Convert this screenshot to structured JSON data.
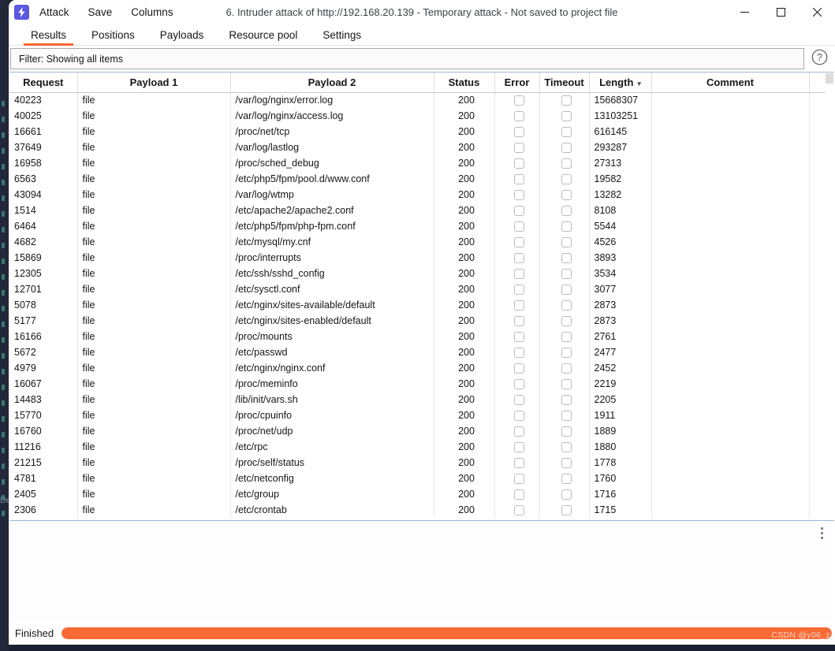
{
  "window": {
    "app_icon": "burp-lightning-icon",
    "title": "6. Intruder attack of http://192.168.20.139 - Temporary attack - Not saved to project file",
    "menu": [
      "Attack",
      "Save",
      "Columns"
    ],
    "controls": {
      "minimize": "minimize-icon",
      "maximize": "maximize-icon",
      "close": "close-icon"
    }
  },
  "tabs": [
    {
      "label": "Results",
      "active": true
    },
    {
      "label": "Positions",
      "active": false
    },
    {
      "label": "Payloads",
      "active": false
    },
    {
      "label": "Resource pool",
      "active": false
    },
    {
      "label": "Settings",
      "active": false
    }
  ],
  "filter": {
    "text": "Filter: Showing all items",
    "help_icon": "question-mark-icon"
  },
  "table": {
    "columns": [
      {
        "key": "request",
        "label": "Request"
      },
      {
        "key": "payload1",
        "label": "Payload 1"
      },
      {
        "key": "payload2",
        "label": "Payload 2"
      },
      {
        "key": "status",
        "label": "Status"
      },
      {
        "key": "error",
        "label": "Error"
      },
      {
        "key": "timeout",
        "label": "Timeout"
      },
      {
        "key": "length",
        "label": "Length",
        "sorted": "desc",
        "sort_icon": "chevron-down-icon"
      },
      {
        "key": "comment",
        "label": "Comment"
      }
    ],
    "rows": [
      {
        "request": "40223",
        "payload1": "file",
        "payload2": "/var/log/nginx/error.log",
        "status": "200",
        "error": false,
        "timeout": false,
        "length": "15668307",
        "comment": ""
      },
      {
        "request": "40025",
        "payload1": "file",
        "payload2": "/var/log/nginx/access.log",
        "status": "200",
        "error": false,
        "timeout": false,
        "length": "13103251",
        "comment": ""
      },
      {
        "request": "16661",
        "payload1": "file",
        "payload2": "/proc/net/tcp",
        "status": "200",
        "error": false,
        "timeout": false,
        "length": "616145",
        "comment": ""
      },
      {
        "request": "37649",
        "payload1": "file",
        "payload2": "/var/log/lastlog",
        "status": "200",
        "error": false,
        "timeout": false,
        "length": "293287",
        "comment": ""
      },
      {
        "request": "16958",
        "payload1": "file",
        "payload2": "/proc/sched_debug",
        "status": "200",
        "error": false,
        "timeout": false,
        "length": "27313",
        "comment": ""
      },
      {
        "request": "6563",
        "payload1": "file",
        "payload2": "/etc/php5/fpm/pool.d/www.conf",
        "status": "200",
        "error": false,
        "timeout": false,
        "length": "19582",
        "comment": ""
      },
      {
        "request": "43094",
        "payload1": "file",
        "payload2": "/var/log/wtmp",
        "status": "200",
        "error": false,
        "timeout": false,
        "length": "13282",
        "comment": ""
      },
      {
        "request": "1514",
        "payload1": "file",
        "payload2": "/etc/apache2/apache2.conf",
        "status": "200",
        "error": false,
        "timeout": false,
        "length": "8108",
        "comment": ""
      },
      {
        "request": "6464",
        "payload1": "file",
        "payload2": "/etc/php5/fpm/php-fpm.conf",
        "status": "200",
        "error": false,
        "timeout": false,
        "length": "5544",
        "comment": ""
      },
      {
        "request": "4682",
        "payload1": "file",
        "payload2": "/etc/mysql/my.cnf",
        "status": "200",
        "error": false,
        "timeout": false,
        "length": "4526",
        "comment": ""
      },
      {
        "request": "15869",
        "payload1": "file",
        "payload2": "/proc/interrupts",
        "status": "200",
        "error": false,
        "timeout": false,
        "length": "3893",
        "comment": ""
      },
      {
        "request": "12305",
        "payload1": "file",
        "payload2": "/etc/ssh/sshd_config",
        "status": "200",
        "error": false,
        "timeout": false,
        "length": "3534",
        "comment": ""
      },
      {
        "request": "12701",
        "payload1": "file",
        "payload2": "/etc/sysctl.conf",
        "status": "200",
        "error": false,
        "timeout": false,
        "length": "3077",
        "comment": ""
      },
      {
        "request": "5078",
        "payload1": "file",
        "payload2": "/etc/nginx/sites-available/default",
        "status": "200",
        "error": false,
        "timeout": false,
        "length": "2873",
        "comment": ""
      },
      {
        "request": "5177",
        "payload1": "file",
        "payload2": "/etc/nginx/sites-enabled/default",
        "status": "200",
        "error": false,
        "timeout": false,
        "length": "2873",
        "comment": ""
      },
      {
        "request": "16166",
        "payload1": "file",
        "payload2": "/proc/mounts",
        "status": "200",
        "error": false,
        "timeout": false,
        "length": "2761",
        "comment": ""
      },
      {
        "request": "5672",
        "payload1": "file",
        "payload2": "/etc/passwd",
        "status": "200",
        "error": false,
        "timeout": false,
        "length": "2477",
        "comment": ""
      },
      {
        "request": "4979",
        "payload1": "file",
        "payload2": "/etc/nginx/nginx.conf",
        "status": "200",
        "error": false,
        "timeout": false,
        "length": "2452",
        "comment": ""
      },
      {
        "request": "16067",
        "payload1": "file",
        "payload2": "/proc/meminfo",
        "status": "200",
        "error": false,
        "timeout": false,
        "length": "2219",
        "comment": ""
      },
      {
        "request": "14483",
        "payload1": "file",
        "payload2": "/lib/init/vars.sh",
        "status": "200",
        "error": false,
        "timeout": false,
        "length": "2205",
        "comment": ""
      },
      {
        "request": "15770",
        "payload1": "file",
        "payload2": "/proc/cpuinfo",
        "status": "200",
        "error": false,
        "timeout": false,
        "length": "1911",
        "comment": ""
      },
      {
        "request": "16760",
        "payload1": "file",
        "payload2": "/proc/net/udp",
        "status": "200",
        "error": false,
        "timeout": false,
        "length": "1889",
        "comment": ""
      },
      {
        "request": "11216",
        "payload1": "file",
        "payload2": "/etc/rpc",
        "status": "200",
        "error": false,
        "timeout": false,
        "length": "1880",
        "comment": ""
      },
      {
        "request": "21215",
        "payload1": "file",
        "payload2": "/proc/self/status",
        "status": "200",
        "error": false,
        "timeout": false,
        "length": "1778",
        "comment": ""
      },
      {
        "request": "4781",
        "payload1": "file",
        "payload2": "/etc/netconfig",
        "status": "200",
        "error": false,
        "timeout": false,
        "length": "1760",
        "comment": ""
      },
      {
        "request": "2405",
        "payload1": "file",
        "payload2": "/etc/group",
        "status": "200",
        "error": false,
        "timeout": false,
        "length": "1716",
        "comment": ""
      },
      {
        "request": "2306",
        "payload1": "file",
        "payload2": "/etc/crontab",
        "status": "200",
        "error": false,
        "timeout": false,
        "length": "1715",
        "comment": ""
      }
    ]
  },
  "lower_pane": {
    "menu_icon": "kebab-menu-icon"
  },
  "status": {
    "label": "Finished",
    "progress_percent": 100
  },
  "watermark": "CSDN @y06_z",
  "background_ghost_text": "De",
  "colors": {
    "accent": "#ff6633",
    "progress": "#f96a34",
    "app_icon": "#5b57e0",
    "desktop": "#1b2030"
  }
}
